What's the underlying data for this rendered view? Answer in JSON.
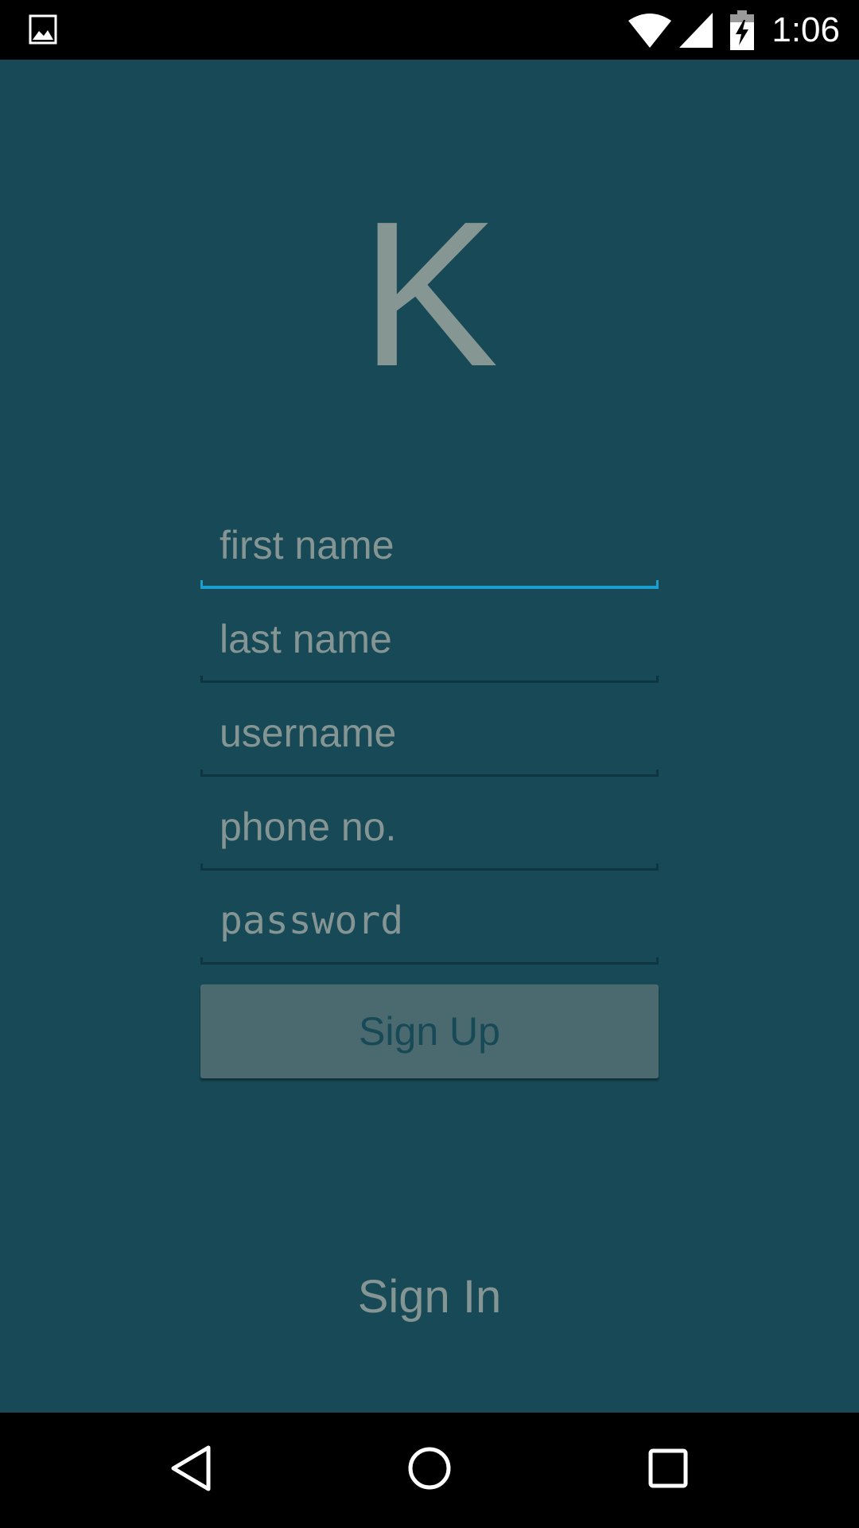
{
  "status_bar": {
    "time": "1:06",
    "icons": [
      "gallery-icon",
      "wifi-icon",
      "cell-signal-icon",
      "battery-charging-icon"
    ]
  },
  "app": {
    "logo_letter": "K",
    "form": {
      "first_name_placeholder": "first name",
      "last_name_placeholder": "last name",
      "username_placeholder": "username",
      "phone_placeholder": "phone no.",
      "password_placeholder": "password",
      "signup_label": "Sign Up"
    },
    "signin_label": "Sign In",
    "colors": {
      "background": "#174956",
      "accent": "#1b9fd1",
      "hint_text": "#849594",
      "button": "#4a6a6f"
    }
  },
  "nav_bar": {
    "icons": [
      "back-icon",
      "home-icon",
      "recents-icon"
    ]
  }
}
